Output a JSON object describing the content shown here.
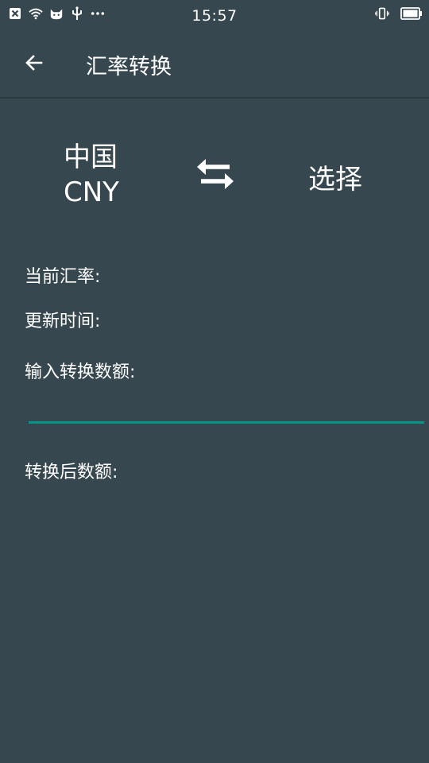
{
  "status_bar": {
    "time": "15:57",
    "icons": [
      "close-box-icon",
      "wifi-icon",
      "cat-icon",
      "usb-icon",
      "more-dots-icon",
      "vibrate-icon",
      "battery-icon"
    ]
  },
  "toolbar": {
    "back_icon": "arrow-left-icon",
    "title": "汇率转换"
  },
  "currency": {
    "from_name": "中国",
    "from_code": "CNY",
    "swap_icon": "swap-arrows-icon",
    "to_label": "选择"
  },
  "info": {
    "current_rate_label": "当前汇率:",
    "update_time_label": "更新时间:",
    "input_amount_label": "输入转换数额:",
    "input_value": "",
    "converted_amount_label": "转换后数额:"
  },
  "colors": {
    "background": "#37474f",
    "accent": "#009688",
    "text": "#ffffff"
  }
}
